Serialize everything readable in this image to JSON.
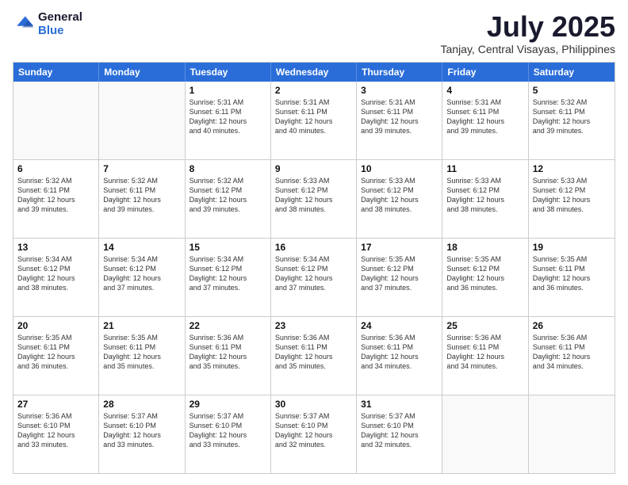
{
  "logo": {
    "general": "General",
    "blue": "Blue"
  },
  "title": "July 2025",
  "subtitle": "Tanjay, Central Visayas, Philippines",
  "days": [
    "Sunday",
    "Monday",
    "Tuesday",
    "Wednesday",
    "Thursday",
    "Friday",
    "Saturday"
  ],
  "weeks": [
    [
      {
        "day": "",
        "text": ""
      },
      {
        "day": "",
        "text": ""
      },
      {
        "day": "1",
        "text": "Sunrise: 5:31 AM\nSunset: 6:11 PM\nDaylight: 12 hours\nand 40 minutes."
      },
      {
        "day": "2",
        "text": "Sunrise: 5:31 AM\nSunset: 6:11 PM\nDaylight: 12 hours\nand 40 minutes."
      },
      {
        "day": "3",
        "text": "Sunrise: 5:31 AM\nSunset: 6:11 PM\nDaylight: 12 hours\nand 39 minutes."
      },
      {
        "day": "4",
        "text": "Sunrise: 5:31 AM\nSunset: 6:11 PM\nDaylight: 12 hours\nand 39 minutes."
      },
      {
        "day": "5",
        "text": "Sunrise: 5:32 AM\nSunset: 6:11 PM\nDaylight: 12 hours\nand 39 minutes."
      }
    ],
    [
      {
        "day": "6",
        "text": "Sunrise: 5:32 AM\nSunset: 6:11 PM\nDaylight: 12 hours\nand 39 minutes."
      },
      {
        "day": "7",
        "text": "Sunrise: 5:32 AM\nSunset: 6:11 PM\nDaylight: 12 hours\nand 39 minutes."
      },
      {
        "day": "8",
        "text": "Sunrise: 5:32 AM\nSunset: 6:12 PM\nDaylight: 12 hours\nand 39 minutes."
      },
      {
        "day": "9",
        "text": "Sunrise: 5:33 AM\nSunset: 6:12 PM\nDaylight: 12 hours\nand 38 minutes."
      },
      {
        "day": "10",
        "text": "Sunrise: 5:33 AM\nSunset: 6:12 PM\nDaylight: 12 hours\nand 38 minutes."
      },
      {
        "day": "11",
        "text": "Sunrise: 5:33 AM\nSunset: 6:12 PM\nDaylight: 12 hours\nand 38 minutes."
      },
      {
        "day": "12",
        "text": "Sunrise: 5:33 AM\nSunset: 6:12 PM\nDaylight: 12 hours\nand 38 minutes."
      }
    ],
    [
      {
        "day": "13",
        "text": "Sunrise: 5:34 AM\nSunset: 6:12 PM\nDaylight: 12 hours\nand 38 minutes."
      },
      {
        "day": "14",
        "text": "Sunrise: 5:34 AM\nSunset: 6:12 PM\nDaylight: 12 hours\nand 37 minutes."
      },
      {
        "day": "15",
        "text": "Sunrise: 5:34 AM\nSunset: 6:12 PM\nDaylight: 12 hours\nand 37 minutes."
      },
      {
        "day": "16",
        "text": "Sunrise: 5:34 AM\nSunset: 6:12 PM\nDaylight: 12 hours\nand 37 minutes."
      },
      {
        "day": "17",
        "text": "Sunrise: 5:35 AM\nSunset: 6:12 PM\nDaylight: 12 hours\nand 37 minutes."
      },
      {
        "day": "18",
        "text": "Sunrise: 5:35 AM\nSunset: 6:12 PM\nDaylight: 12 hours\nand 36 minutes."
      },
      {
        "day": "19",
        "text": "Sunrise: 5:35 AM\nSunset: 6:11 PM\nDaylight: 12 hours\nand 36 minutes."
      }
    ],
    [
      {
        "day": "20",
        "text": "Sunrise: 5:35 AM\nSunset: 6:11 PM\nDaylight: 12 hours\nand 36 minutes."
      },
      {
        "day": "21",
        "text": "Sunrise: 5:35 AM\nSunset: 6:11 PM\nDaylight: 12 hours\nand 35 minutes."
      },
      {
        "day": "22",
        "text": "Sunrise: 5:36 AM\nSunset: 6:11 PM\nDaylight: 12 hours\nand 35 minutes."
      },
      {
        "day": "23",
        "text": "Sunrise: 5:36 AM\nSunset: 6:11 PM\nDaylight: 12 hours\nand 35 minutes."
      },
      {
        "day": "24",
        "text": "Sunrise: 5:36 AM\nSunset: 6:11 PM\nDaylight: 12 hours\nand 34 minutes."
      },
      {
        "day": "25",
        "text": "Sunrise: 5:36 AM\nSunset: 6:11 PM\nDaylight: 12 hours\nand 34 minutes."
      },
      {
        "day": "26",
        "text": "Sunrise: 5:36 AM\nSunset: 6:11 PM\nDaylight: 12 hours\nand 34 minutes."
      }
    ],
    [
      {
        "day": "27",
        "text": "Sunrise: 5:36 AM\nSunset: 6:10 PM\nDaylight: 12 hours\nand 33 minutes."
      },
      {
        "day": "28",
        "text": "Sunrise: 5:37 AM\nSunset: 6:10 PM\nDaylight: 12 hours\nand 33 minutes."
      },
      {
        "day": "29",
        "text": "Sunrise: 5:37 AM\nSunset: 6:10 PM\nDaylight: 12 hours\nand 33 minutes."
      },
      {
        "day": "30",
        "text": "Sunrise: 5:37 AM\nSunset: 6:10 PM\nDaylight: 12 hours\nand 32 minutes."
      },
      {
        "day": "31",
        "text": "Sunrise: 5:37 AM\nSunset: 6:10 PM\nDaylight: 12 hours\nand 32 minutes."
      },
      {
        "day": "",
        "text": ""
      },
      {
        "day": "",
        "text": ""
      }
    ]
  ]
}
